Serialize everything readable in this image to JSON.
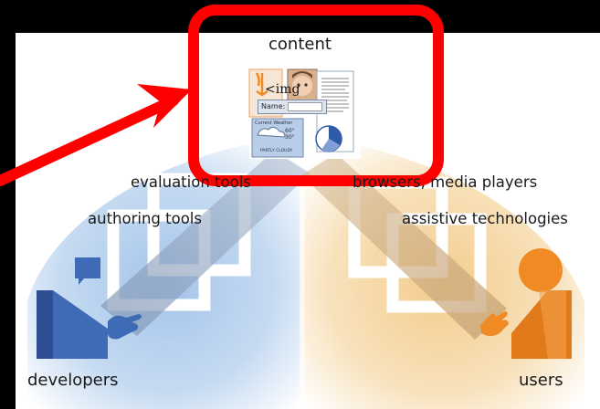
{
  "diagram": {
    "center": {
      "label": "content"
    },
    "left_side": {
      "labels": [
        "evaluation tools",
        "authoring tools"
      ],
      "actor": "developers"
    },
    "right_side": {
      "labels": [
        "browsers, media players",
        "assistive technologies"
      ],
      "actor": "users"
    },
    "content_thumbnail": {
      "img_tag": "<img",
      "name_field_label": "Name:",
      "weather_title": "Current Weather",
      "weather_high": "60°",
      "weather_low": "30°",
      "weather_caption": "PARTLY CLOUDY"
    }
  },
  "colors": {
    "background": "#000000",
    "left_blue": "#a9c8ea",
    "right_orange": "#f6d49a",
    "highlight_red": "#ff0000"
  }
}
